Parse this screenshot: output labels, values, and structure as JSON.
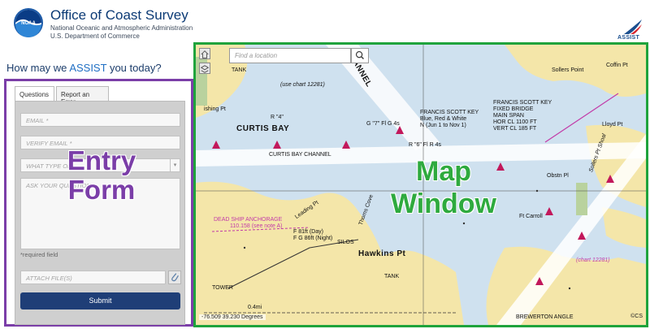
{
  "header": {
    "org_title": "Office of Coast Survey",
    "org_sub_line1": "National Oceanic and Atmospheric Administration",
    "org_sub_line2": "U.S. Department of Commerce",
    "logo_text": "NOAA",
    "assist_text": "ASSIST"
  },
  "form": {
    "heading_prefix": "How may we ",
    "heading_highlight": "ASSIST",
    "heading_suffix": " you today?",
    "tabs": [
      {
        "label": "Questions",
        "active": true
      },
      {
        "label": "Report an Error",
        "active": false
      }
    ],
    "email_placeholder": "EMAIL *",
    "verify_email_placeholder": "VERIFY EMAIL *",
    "type_placeholder": "WHAT TYPE OF",
    "question_placeholder": "ASK YOUR QUESTION *",
    "required_note": "*required field",
    "attach_placeholder": "ATTACH FILE(S)",
    "submit_label": "Submit",
    "overlay_line1": "Entry",
    "overlay_line2": "Form"
  },
  "map": {
    "search_placeholder": "Find a location",
    "coords": "-76.509 39.230 Degrees",
    "attribution": "©CS",
    "overlay_line1": "Map",
    "overlay_line2": "Window",
    "labels": {
      "tank_top": "TANK",
      "use_chart": "(use chart 12281)",
      "annel": "ANNEL",
      "sollers_point": "Sollers Point",
      "coffin_pt": "Coffin Pt",
      "fsk_title": "FRANCIS SCOTT KEY",
      "fsk_line2": "FIXED BRIDGE",
      "fsk_line3": "MAIN SPAN",
      "fsk_line4": "HOR CL 1100 FT",
      "fsk_line5": "VERT CL 185 FT",
      "fsk_light1": "FRANCIS SCOTT KEY",
      "fsk_light2": "Blue, Red & White",
      "fsk_light3": "N (Jun 1 to Nov 1)",
      "curtis_bay": "CURTIS BAY",
      "curtis_bay_channel": "CURTIS BAY CHANNEL",
      "fishing_pt": "ishing Pt",
      "obstn_pl": "Obstn Pl",
      "lloyd_pt": "Lloyd Pt",
      "sollers_pt_shoal": "Sollers Pt Shoal",
      "dead_ship1": "DEAD SHIP ANCHORAGE",
      "dead_ship2": "110.158 (see note A)",
      "leading_pt": "Leading Pt",
      "thoms_cove": "Thoms Cove",
      "fort_carroll": "Ft Carroll",
      "light_day": "F 81ft (Day)",
      "light_night": "F G 86ft (Night)",
      "silos": "SILOS",
      "hawkins_pt": "Hawkins Pt",
      "tank_bottom": "TANK",
      "tower": "TOWER",
      "brewerton": "BREWERTON ANGLE",
      "chart_12281": "(chart 12281)",
      "g7_fg4s": "G \"7\"  Fl G 4s",
      "r6_fr4s": "R \"6\"  Fl R 4s",
      "r4": "R \"4\"",
      "mi": "0.4mi"
    }
  },
  "colors": {
    "form_border": "#7b3ea8",
    "map_border": "#1fa33c",
    "submit_bg": "#1f3e77",
    "water": "#cfe1ef",
    "land": "#f4e6a9",
    "channel": "#ffffff",
    "buoy": "#c2185b"
  },
  "icons": [
    "noaa-logo-icon",
    "assist-logo-icon",
    "search-icon",
    "attach-icon",
    "chevron-down-icon",
    "home-icon",
    "layers-icon"
  ]
}
